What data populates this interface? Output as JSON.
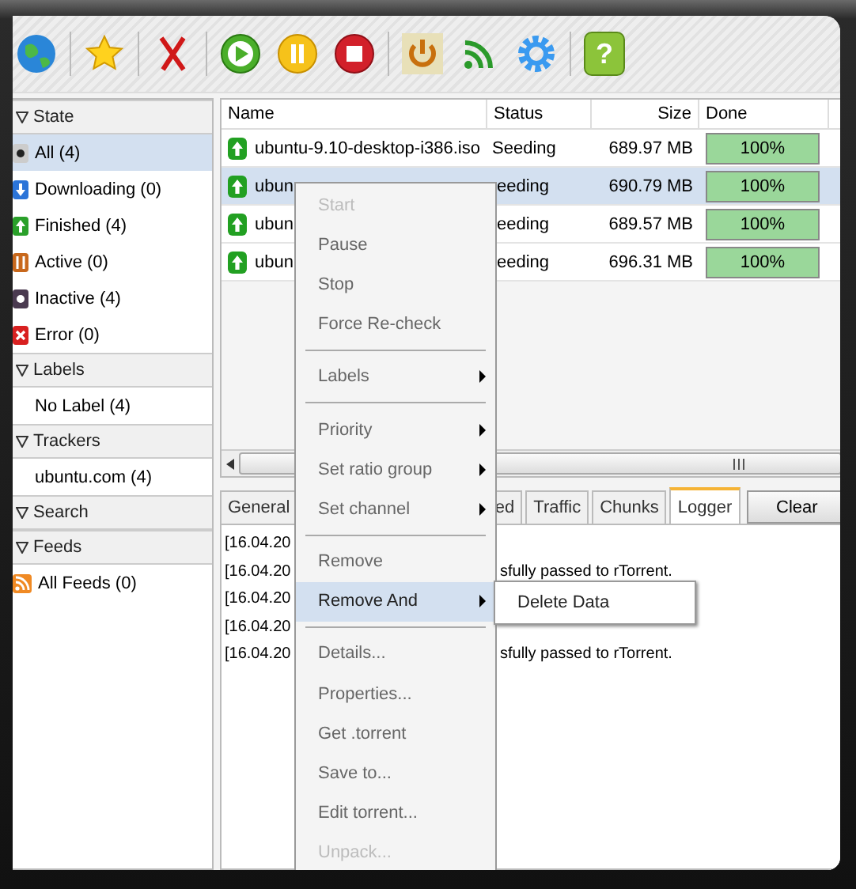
{
  "toolbar": {
    "help_label": "?"
  },
  "sidebar": [
    {
      "title": "State",
      "expanded": true,
      "items": [
        {
          "label": "All (4)",
          "kind": "all",
          "selected": true
        },
        {
          "label": "Downloading (0)",
          "kind": "downloading",
          "selected": false
        },
        {
          "label": "Finished (4)",
          "kind": "finished",
          "selected": false
        },
        {
          "label": "Active (0)",
          "kind": "active",
          "selected": false
        },
        {
          "label": "Inactive (4)",
          "kind": "inactive",
          "selected": false
        },
        {
          "label": "Error (0)",
          "kind": "error",
          "selected": false
        }
      ]
    },
    {
      "title": "Labels",
      "expanded": true,
      "items": [
        {
          "label": "No Label (4)",
          "kind": "none",
          "selected": false
        }
      ]
    },
    {
      "title": "Trackers",
      "expanded": true,
      "items": [
        {
          "label": "ubuntu.com (4)",
          "kind": "none",
          "selected": false
        }
      ]
    },
    {
      "title": "Search",
      "expanded": true
    },
    {
      "title": "Feeds",
      "expanded": true,
      "items": [
        {
          "label": "All Feeds (0)",
          "kind": "feed",
          "selected": false
        }
      ]
    }
  ],
  "table": {
    "columns": [
      "Name",
      "Status",
      "Size",
      "Done"
    ],
    "rows": [
      {
        "name": "ubuntu-9.10-desktop-i386.iso",
        "status": "Seeding",
        "size": "689.97 MB",
        "done": "100%",
        "level": 1,
        "selected": false
      },
      {
        "name": "ubun",
        "status": "eeding",
        "size": "690.79 MB",
        "done": "100%",
        "level": 1,
        "selected": true
      },
      {
        "name": "ubun",
        "status": "eeding",
        "size": "689.57 MB",
        "done": "100%",
        "level": 1,
        "selected": false
      },
      {
        "name": "ubun",
        "status": "eeding",
        "size": "696.31 MB",
        "done": "100%",
        "level": 1,
        "selected": false
      }
    ]
  },
  "tabs": [
    {
      "label": "General",
      "selected": false
    },
    {
      "label": "ed",
      "selected": false
    },
    {
      "label": "Traffic",
      "selected": false
    },
    {
      "label": "Chunks",
      "selected": false
    },
    {
      "label": "Logger",
      "selected": true
    }
  ],
  "clear_button": "Clear",
  "log": [
    {
      "time": "[16.04.20"
    },
    {
      "time": "[16.04.20",
      "message": "sfully passed to rTorrent."
    },
    {
      "time": "[16.04.20"
    },
    {
      "time": "[16.04.20"
    },
    {
      "time": "[16.04.20",
      "message": "sfully passed to rTorrent."
    }
  ],
  "context_menu": {
    "items": [
      {
        "kind": "item",
        "label": "Start",
        "disabled": true,
        "submenu": false,
        "selected": false
      },
      {
        "kind": "item",
        "label": "Pause",
        "disabled": false,
        "submenu": false,
        "selected": false
      },
      {
        "kind": "item",
        "label": "Stop",
        "disabled": false,
        "submenu": false,
        "selected": false
      },
      {
        "kind": "item",
        "label": "Force Re-check",
        "disabled": false,
        "submenu": false,
        "selected": false
      },
      {
        "kind": "separator"
      },
      {
        "kind": "item",
        "label": "Labels",
        "disabled": false,
        "submenu": true,
        "selected": false
      },
      {
        "kind": "separator"
      },
      {
        "kind": "item",
        "label": "Priority",
        "disabled": false,
        "submenu": true,
        "selected": false
      },
      {
        "kind": "item",
        "label": "Set ratio group",
        "disabled": false,
        "submenu": true,
        "selected": false
      },
      {
        "kind": "item",
        "label": "Set channel",
        "disabled": false,
        "submenu": true,
        "selected": false
      },
      {
        "kind": "separator"
      },
      {
        "kind": "item",
        "label": "Remove",
        "disabled": false,
        "submenu": false,
        "selected": false
      },
      {
        "kind": "item",
        "label": "Remove And",
        "disabled": false,
        "submenu": true,
        "selected": true
      },
      {
        "kind": "separator"
      },
      {
        "kind": "item",
        "label": "Details...",
        "disabled": false,
        "submenu": false,
        "selected": false
      },
      {
        "kind": "item",
        "label": "Properties...",
        "disabled": false,
        "submenu": false,
        "selected": false
      },
      {
        "kind": "item",
        "label": "Get .torrent",
        "disabled": false,
        "submenu": false,
        "selected": false
      },
      {
        "kind": "item",
        "label": "Save to...",
        "disabled": false,
        "submenu": false,
        "selected": false
      },
      {
        "kind": "item",
        "label": "Edit torrent...",
        "disabled": false,
        "submenu": false,
        "selected": false
      },
      {
        "kind": "item",
        "label": "Unpack...",
        "disabled": true,
        "submenu": false,
        "selected": false
      }
    ]
  },
  "submenu": {
    "items": [
      {
        "label": "Delete Data"
      }
    ]
  }
}
